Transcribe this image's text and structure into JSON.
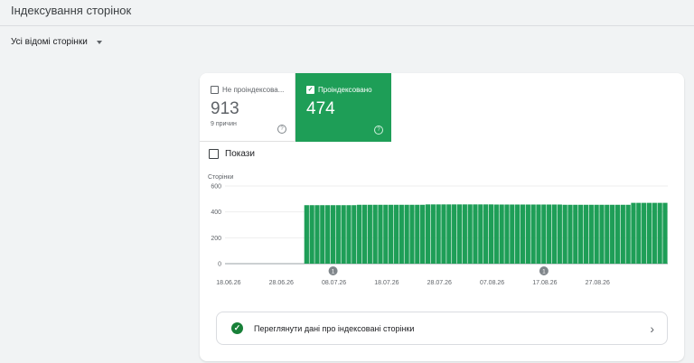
{
  "page": {
    "title": "Індексування сторінок"
  },
  "filter": {
    "label": "Усі відомі сторінки"
  },
  "tiles": {
    "not_indexed": {
      "label": "Не проіндексова...",
      "value": "913",
      "sub": "9 причин",
      "checked": false
    },
    "indexed": {
      "label": "Проіндексовано",
      "value": "474",
      "checked": true
    }
  },
  "impressions": {
    "label": "Покази"
  },
  "colors": {
    "accent": "#1e9e57",
    "bar": "#1e9e57"
  },
  "chart_data": {
    "type": "bar",
    "ylabel": "Сторінки",
    "ylim": [
      0,
      600
    ],
    "yticks": [
      "0",
      "200",
      "400",
      "600"
    ],
    "x_tick_labels": [
      "18.06.26",
      "28.06.26",
      "08.07.26",
      "18.07.26",
      "28.07.26",
      "07.08.26",
      "17.08.26",
      "27.08.26"
    ],
    "x_start_label": "18.06.26",
    "series": [
      {
        "values": [
          0,
          0,
          0,
          0,
          0,
          0,
          0,
          0,
          0,
          0,
          0,
          0,
          0,
          0,
          0,
          452,
          452,
          452,
          452,
          452,
          452,
          452,
          452,
          452,
          452,
          455,
          455,
          455,
          455,
          455,
          455,
          455,
          455,
          455,
          455,
          455,
          455,
          455,
          458,
          458,
          458,
          458,
          458,
          458,
          458,
          458,
          458,
          458,
          458,
          458,
          458,
          457,
          457,
          457,
          457,
          457,
          457,
          457,
          457,
          457,
          457,
          457,
          457,
          457,
          455,
          455,
          455,
          455,
          455,
          455,
          455,
          455,
          455,
          455,
          455,
          455,
          455,
          470,
          470,
          470,
          470,
          470,
          470,
          470
        ]
      }
    ],
    "annotations": [
      {
        "date": "08.07.26",
        "label": "1"
      },
      {
        "date": "17.08.26",
        "label": "1"
      }
    ]
  },
  "link": {
    "label": "Переглянути дані про індексовані сторінки"
  },
  "icons": {
    "ok": "check-circle-icon",
    "chevron": "chevron-right-icon",
    "caret": "caret-down-icon",
    "help": "help-icon"
  }
}
